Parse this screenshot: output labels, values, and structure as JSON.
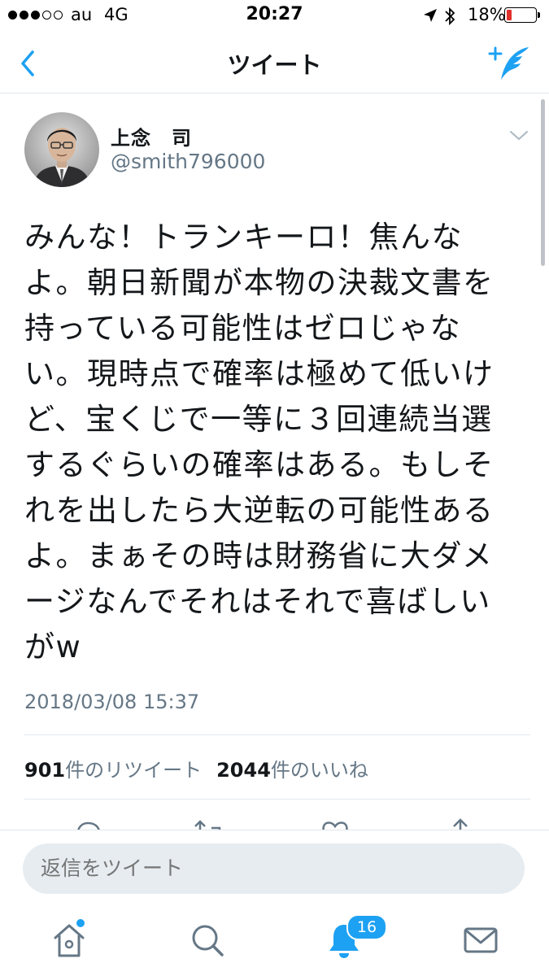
{
  "status_bar": {
    "carrier": "au",
    "network": "4G",
    "time": "20:27",
    "battery_percent": "18%",
    "battery_level": 0.18,
    "icons": [
      "signal-dots-icon",
      "location-arrow-icon",
      "bluetooth-icon",
      "battery-icon"
    ]
  },
  "nav": {
    "title": "ツイート",
    "back_icon": "chevron-left-icon",
    "compose_icon": "compose-tweet-icon"
  },
  "tweet": {
    "author_name": "上念　司",
    "author_handle": "@smith796000",
    "text": "みんな！トランキーロ！焦んなよ。朝日新聞が本物の決裁文書を持っている可能性はゼロじゃない。現時点で確率は極めて低いけど、宝くじで一等に３回連続当選するぐらいの確率はある。もしそれを出したら大逆転の可能性あるよ。まぁその時は財務省に大ダメージなんでそれはそれで喜ばしいがw",
    "timestamp": "2018/03/08 15:37",
    "retweet_count": "901",
    "retweet_label": "件のリツイート",
    "like_count": "2044",
    "like_label": "件のいいね"
  },
  "reply": {
    "placeholder": "返信をツイート"
  },
  "tab_bar": {
    "notifications_badge": "16",
    "tabs": [
      "home-icon",
      "search-icon",
      "notifications-bell-icon",
      "messages-envelope-icon"
    ]
  },
  "colors": {
    "accent": "#1da1f2",
    "text": "#14171a",
    "secondary": "#657786",
    "battery_low": "#e0312c"
  }
}
